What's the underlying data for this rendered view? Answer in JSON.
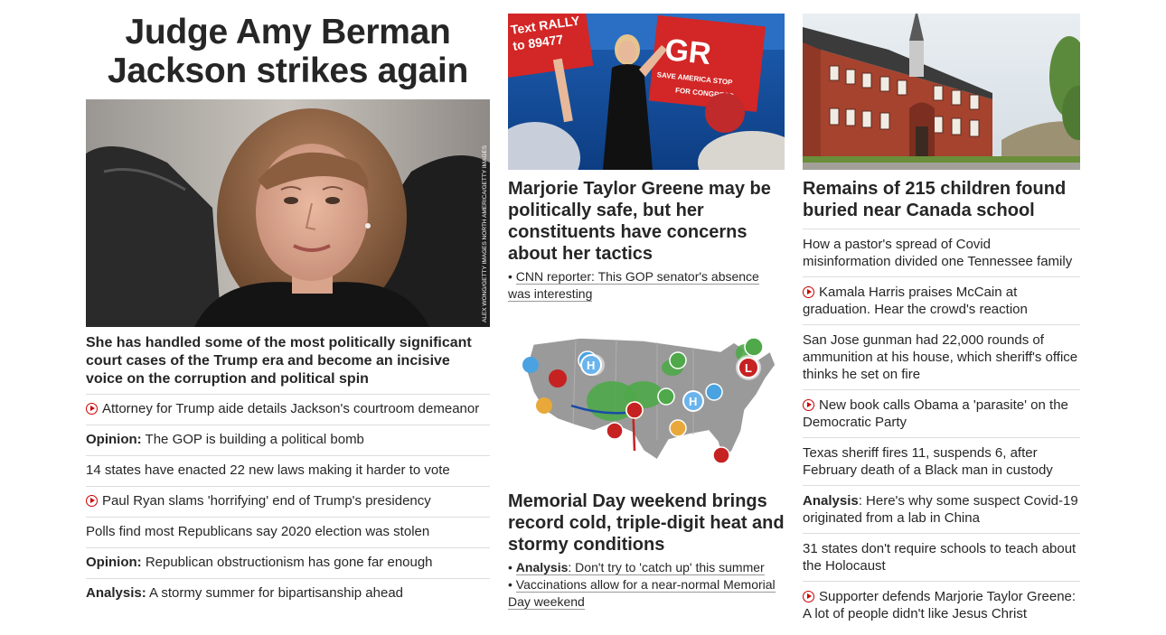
{
  "col1": {
    "title": "Judge Amy Berman Jackson strikes again",
    "photo_credit": "ALEX WONG/GETTY IMAGES NORTH AMERICA/GETTY IMAGES",
    "description": "She has handled some of the most politically significant court cases of the Trump era and become an incisive voice on the corruption and political spin",
    "items": [
      {
        "video": true,
        "kicker": "",
        "text": "Attorney for Trump aide details Jackson's courtroom demeanor"
      },
      {
        "video": false,
        "kicker": "Opinion:",
        "text": " The GOP is building a political bomb"
      },
      {
        "video": false,
        "kicker": "",
        "text": "14 states have enacted 22 new laws making it harder to vote"
      },
      {
        "video": true,
        "kicker": "",
        "text": "Paul Ryan slams 'horrifying' end of Trump's presidency"
      },
      {
        "video": false,
        "kicker": "",
        "text": "Polls find most Republicans say 2020 election was stolen"
      },
      {
        "video": false,
        "kicker": "Opinion:",
        "text": " Republican obstructionism has gone far enough"
      },
      {
        "video": false,
        "kicker": "Analysis:",
        "text": " A stormy summer for bipartisanship ahead"
      }
    ]
  },
  "col2": {
    "photo_sign_text": "Text RALLY to 89477",
    "photo_sign2_text": "SAVE AMERICA STOP SOCIALISM FOR CONGRESS",
    "mtg_headline": "Marjorie Taylor Greene may be politically safe, but her constituents have concerns about her tactics",
    "mtg_bullets": [
      {
        "kicker": "",
        "text": "CNN reporter: This GOP senator's absence was interesting"
      }
    ],
    "map_headline": "Memorial Day weekend brings record cold, triple-digit heat and stormy conditions",
    "map_bullets": [
      {
        "kicker": "Analysis",
        "text": ": Don't try to 'catch up' this summer"
      },
      {
        "kicker": "",
        "text": "Vaccinations allow for a near-normal Memorial Day weekend"
      }
    ],
    "map_labels": {
      "high": "H",
      "low": "L"
    }
  },
  "col3": {
    "headline": "Remains of 215 children found buried near Canada school",
    "items": [
      {
        "video": false,
        "kicker": "",
        "text": "How a pastor's spread of Covid misinformation divided one Tennessee family"
      },
      {
        "video": true,
        "kicker": "",
        "text": "Kamala Harris praises McCain at graduation. Hear the crowd's reaction"
      },
      {
        "video": false,
        "kicker": "",
        "text": "San Jose gunman had 22,000 rounds of ammunition at his house, which sheriff's office thinks he set on fire"
      },
      {
        "video": true,
        "kicker": "",
        "text": "New book calls Obama a 'parasite' on the Democratic Party"
      },
      {
        "video": false,
        "kicker": "",
        "text": "Texas sheriff fires 11, suspends 6, after February death of a Black man in custody"
      },
      {
        "video": false,
        "kicker": "Analysis",
        "text": ": Here's why some suspect Covid-19 originated from a lab in China"
      },
      {
        "video": false,
        "kicker": "",
        "text": "31 states don't require schools to teach about the Holocaust"
      },
      {
        "video": true,
        "kicker": "",
        "text": "Supporter defends Marjorie Taylor Greene: A lot of people didn't like Jesus Christ"
      }
    ]
  },
  "colors": {
    "accent": "#cc0000",
    "text": "#262626",
    "divider": "#dddddd"
  },
  "icons": {
    "video": "play-circle-icon"
  }
}
